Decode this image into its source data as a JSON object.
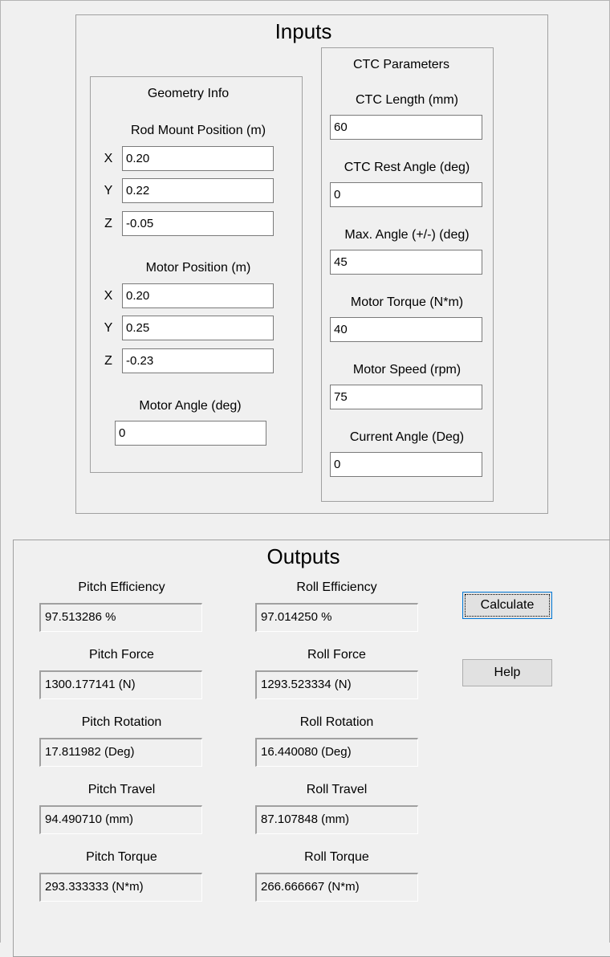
{
  "inputs": {
    "title": "Inputs",
    "geometry": {
      "title": "Geometry Info",
      "rod_mount": {
        "label": "Rod Mount Position (m)",
        "x_label": "X",
        "x": "0.20",
        "y_label": "Y",
        "y": "0.22",
        "z_label": "Z",
        "z": "-0.05"
      },
      "motor_position": {
        "label": "Motor Position (m)",
        "x_label": "X",
        "x": "0.20",
        "y_label": "Y",
        "y": "0.25",
        "z_label": "Z",
        "z": "-0.23"
      },
      "motor_angle": {
        "label": "Motor Angle (deg)",
        "value": "0"
      }
    },
    "ctc": {
      "title": "CTC Parameters",
      "length": {
        "label": "CTC Length (mm)",
        "value": "60"
      },
      "rest_angle": {
        "label": "CTC Rest Angle (deg)",
        "value": "0"
      },
      "max_angle": {
        "label": "Max. Angle (+/-) (deg)",
        "value": "45"
      },
      "motor_torque": {
        "label": "Motor Torque (N*m)",
        "value": "40"
      },
      "motor_speed": {
        "label": "Motor Speed (rpm)",
        "value": "75"
      },
      "current_angle": {
        "label": "Current Angle (Deg)",
        "value": "0"
      }
    }
  },
  "outputs": {
    "title": "Outputs",
    "pitch_efficiency": {
      "label": "Pitch Efficiency",
      "value": "97.513286   %"
    },
    "roll_efficiency": {
      "label": "Roll Efficiency",
      "value": "97.014250   %"
    },
    "pitch_force": {
      "label": "Pitch Force",
      "value": "1300.177141   (N)"
    },
    "roll_force": {
      "label": "Roll Force",
      "value": "1293.523334   (N)"
    },
    "pitch_rotation": {
      "label": "Pitch Rotation",
      "value": "17.811982   (Deg)"
    },
    "roll_rotation": {
      "label": "Roll Rotation",
      "value": "16.440080   (Deg)"
    },
    "pitch_travel": {
      "label": "Pitch Travel",
      "value": "94.490710   (mm)"
    },
    "roll_travel": {
      "label": "Roll Travel",
      "value": "87.107848   (mm)"
    },
    "pitch_torque": {
      "label": "Pitch Torque",
      "value": "293.333333   (N*m)"
    },
    "roll_torque": {
      "label": "Roll Torque",
      "value": "266.666667   (N*m)"
    }
  },
  "buttons": {
    "calculate": "Calculate",
    "help": "Help"
  }
}
